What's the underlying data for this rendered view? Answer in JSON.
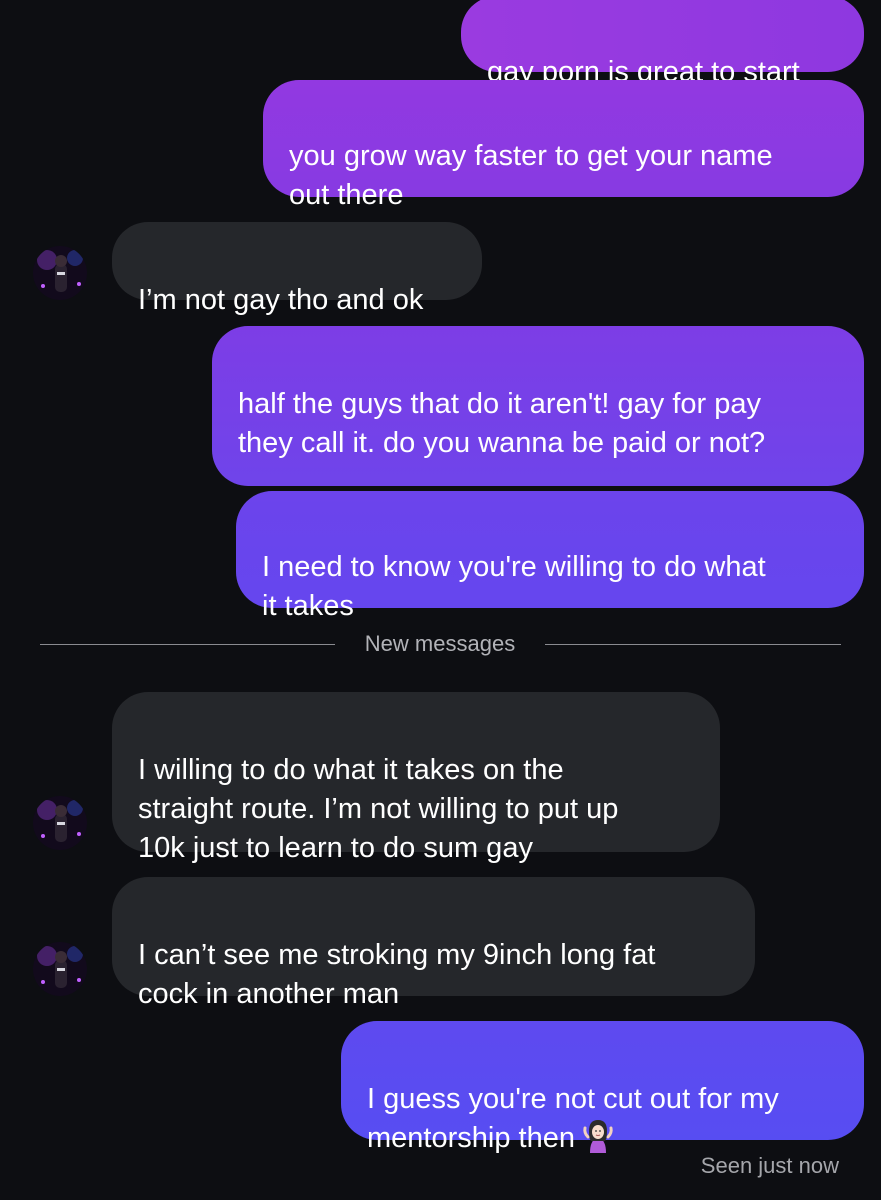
{
  "conversation": {
    "messages": [
      {
        "sender": "me",
        "text": "gay porn is great to start"
      },
      {
        "sender": "me",
        "text": "you grow way faster to get your name\nout there"
      },
      {
        "sender": "them",
        "text": "I’m not gay tho and ok"
      },
      {
        "sender": "me",
        "text": "half the guys that do it aren't! gay for pay\nthey call it. do you wanna be paid or not?"
      },
      {
        "sender": "me",
        "text": "I need to know you're willing to do what\nit takes"
      },
      {
        "sender": "them",
        "text": "I willing to do what it takes on the\nstraight route. I’m not willing to put up\n10k just to learn to do sum gay"
      },
      {
        "sender": "them",
        "text": "I can’t see me stroking my 9inch long fat\ncock in another man"
      },
      {
        "sender": "me",
        "text": "I guess you're not cut out for my\nmentorship then",
        "emoji": "woman-shrugging-emoji"
      }
    ],
    "new_messages_label": "New messages",
    "seen_status": "Seen just now"
  },
  "colors": {
    "background": "#0d0e12",
    "incoming_bubble": "#25272b",
    "outgoing_gradient_top": "#9b3ae0",
    "outgoing_gradient_bottom": "#5a4ef0"
  }
}
